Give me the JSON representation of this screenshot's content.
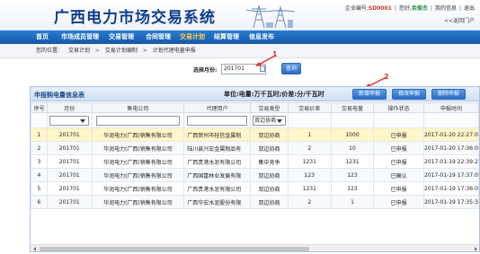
{
  "header": {
    "title": "广西电力市场交易系统",
    "company_label": "企业编号:",
    "company_code": "SD0001",
    "greeting": "您好,",
    "user_name": "余俊杰",
    "links": [
      "我的信息",
      "退出"
    ],
    "back_link": "<<返回门户"
  },
  "nav": {
    "items": [
      "首页",
      "市场成员管理",
      "交易管理",
      "合同管理",
      "交易计划",
      "结算管理",
      "信息发布"
    ],
    "active_index": 4
  },
  "breadcrumb": {
    "label": "您的位置:",
    "items": [
      "交易计划",
      "交易计划编制",
      "计划代理电量申报"
    ]
  },
  "query": {
    "label": "选择月份:",
    "value": "201701",
    "button": "查询"
  },
  "annotations": [
    "1",
    "2"
  ],
  "panel": {
    "title": "申报购电量信息表",
    "unit_text": "单位:电量:万千瓦时;价差:分/千瓦时",
    "buttons": [
      "新增申报",
      "修改申报",
      "删除申报"
    ]
  },
  "table": {
    "columns": [
      "序号",
      "月份",
      "售电公司",
      "代理用户",
      "交易类型",
      "交易价差",
      "交易电量",
      "操作状态",
      "申报时间"
    ],
    "rows": [
      [
        "1",
        "201701",
        "华润电力(广西)销售有限公司",
        "广西贺州市桂信金属制",
        "双边协商",
        "1",
        "1000",
        "已申报",
        "2017-01-20 22:27:0"
      ],
      [
        "2",
        "201701",
        "华润电力(广西)销售有限公司",
        "陆川县兴宏金属制品有",
        "双边协商",
        "2",
        "10",
        "已申报",
        "2017-01-20 17:36:0"
      ],
      [
        "3",
        "201701",
        "华润电力(广西)销售有限公司",
        "广西贵港水泥有限公司",
        "集中竞争",
        "1231",
        "1231",
        "已申报",
        "2017-01-19 22:39:2"
      ],
      [
        "4",
        "201701",
        "华润电力(广西)销售有限公司",
        "广西国富林业发展有限",
        "双边协商",
        "123",
        "123",
        "已确认",
        "2017-01-19 17:37:0"
      ],
      [
        "5",
        "201701",
        "华润电力(广西)销售有限公司",
        "广西贵港水泥有限公司",
        "双边协商",
        "1231",
        "123",
        "已申报",
        "2017-01-19 17:36:0"
      ],
      [
        "6",
        "201701",
        "华润电力(广西)销售有限公司",
        "广西华宏水泥股份有限",
        "双边协商",
        "2",
        "1",
        "已申报",
        "2017-01-19 17:35:3"
      ]
    ],
    "selected_row": 0,
    "filter_default": "双边协商"
  },
  "colors": {
    "nav_bg": "#1f6cc0",
    "nav_active": "#ffd34d",
    "title_blue": "#0f3c8c",
    "button_blue": "#2a6cc4",
    "selected_row": "#fff6c9",
    "annotation_red": "#e0301e"
  }
}
